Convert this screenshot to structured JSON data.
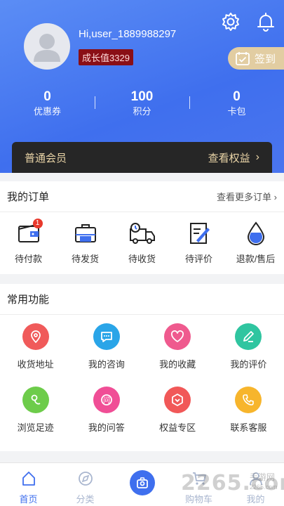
{
  "profile": {
    "username": "Hi,user_1889988297",
    "growth_badge": "成长值3329",
    "signin_label": "签到"
  },
  "stats": [
    {
      "value": "0",
      "label": "优惠券"
    },
    {
      "value": "100",
      "label": "积分"
    },
    {
      "value": "0",
      "label": "卡包"
    }
  ],
  "member": {
    "level": "普通会员",
    "rights_label": "查看权益"
  },
  "orders": {
    "title": "我的订单",
    "more_label": "查看更多订单",
    "items": [
      {
        "label": "待付款",
        "icon": "wallet-icon",
        "badge": "1"
      },
      {
        "label": "待发货",
        "icon": "briefcase-icon"
      },
      {
        "label": "待收货",
        "icon": "delivery-truck-icon"
      },
      {
        "label": "待评价",
        "icon": "edit-note-icon"
      },
      {
        "label": "退款/售后",
        "icon": "water-drop-icon"
      }
    ]
  },
  "functions": {
    "title": "常用功能",
    "items": [
      {
        "label": "收货地址",
        "icon": "location-pin-icon",
        "color": "#f05a5a"
      },
      {
        "label": "我的咨询",
        "icon": "chat-icon",
        "color": "#2aa5e8"
      },
      {
        "label": "我的收藏",
        "icon": "heart-icon",
        "color": "#ef5a8e"
      },
      {
        "label": "我的评价",
        "icon": "pencil-icon",
        "color": "#2fc5a0"
      },
      {
        "label": "浏览足迹",
        "icon": "footprint-icon",
        "color": "#6dcc4a"
      },
      {
        "label": "我的问答",
        "icon": "question-icon",
        "color": "#f04e96"
      },
      {
        "label": "权益专区",
        "icon": "shield-icon",
        "color": "#f15858"
      },
      {
        "label": "联系客服",
        "icon": "phone-icon",
        "color": "#f7b52c"
      }
    ]
  },
  "tabbar": [
    {
      "label": "首页",
      "icon": "home-icon"
    },
    {
      "label": "分类",
      "icon": "compass-icon"
    },
    {
      "label": "",
      "icon": "scan-center-icon"
    },
    {
      "label": "购物车",
      "icon": "cart-icon"
    },
    {
      "label": "我的",
      "icon": "user-icon"
    }
  ],
  "watermark": {
    "main": "2265.com",
    "sub_top": "手游网",
    "sub_bottom": "2265.com"
  },
  "colors": {
    "primary": "#3f6fee",
    "gold": "#e2cda2",
    "badge_red": "#8a0f16"
  }
}
